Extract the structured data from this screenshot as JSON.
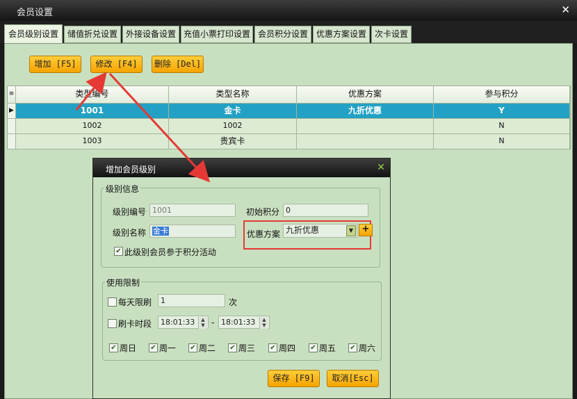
{
  "window": {
    "title": "会员设置",
    "close_icon": "✕"
  },
  "tabs": [
    {
      "label": "会员级别设置",
      "active": true
    },
    {
      "label": "储值折兑设置",
      "active": false
    },
    {
      "label": "外接设备设置",
      "active": false
    },
    {
      "label": "充值小票打印设置",
      "active": false
    },
    {
      "label": "会员积分设置",
      "active": false
    },
    {
      "label": "优惠方案设置",
      "active": false
    },
    {
      "label": "次卡设置",
      "active": false
    }
  ],
  "toolbar": {
    "add_label": "增加 [F5]",
    "edit_label": "修改 [F4]",
    "delete_label": "删除 [Del]"
  },
  "grid": {
    "columns": [
      "类型编号",
      "类型名称",
      "优惠方案",
      "参与积分"
    ],
    "rows": [
      {
        "code": "1001",
        "name": "金卡",
        "scheme": "九折优惠",
        "points": "Y",
        "selected": true
      },
      {
        "code": "1002",
        "name": "1002",
        "scheme": "",
        "points": "N",
        "selected": false
      },
      {
        "code": "1003",
        "name": "贵宾卡",
        "scheme": "",
        "points": "N",
        "selected": false
      }
    ]
  },
  "dialog": {
    "title": "增加会员级别",
    "info": {
      "legend": "级别信息",
      "code_label": "级别编号",
      "code_value": "1001",
      "init_points_label": "初始积分",
      "init_points_value": "0",
      "name_label": "级别名称",
      "name_value": "金卡",
      "scheme_label": "优惠方案",
      "scheme_value": "九折优惠",
      "points_checkbox_label": "此级别会员参于积分活动",
      "points_checked": true
    },
    "limit": {
      "legend": "使用限制",
      "daily_label": "每天限刷",
      "daily_value": "1",
      "daily_unit": "次",
      "daily_checked": false,
      "period_label": "刷卡时段",
      "time_start": "18:01:33",
      "time_sep": "-",
      "time_end": "18:01:33",
      "period_checked": false,
      "weekdays": [
        {
          "label": "周日",
          "checked": true
        },
        {
          "label": "周一",
          "checked": true
        },
        {
          "label": "周二",
          "checked": true
        },
        {
          "label": "周三",
          "checked": true
        },
        {
          "label": "周四",
          "checked": true
        },
        {
          "label": "周五",
          "checked": true
        },
        {
          "label": "周六",
          "checked": true
        }
      ]
    },
    "save_label": "保存 [F9]",
    "cancel_label": "取消[Esc]"
  },
  "colors": {
    "accent": "#22a1c4",
    "highlight": "#e53935",
    "button": "#f5a300",
    "panel": "#c9e0c0"
  }
}
